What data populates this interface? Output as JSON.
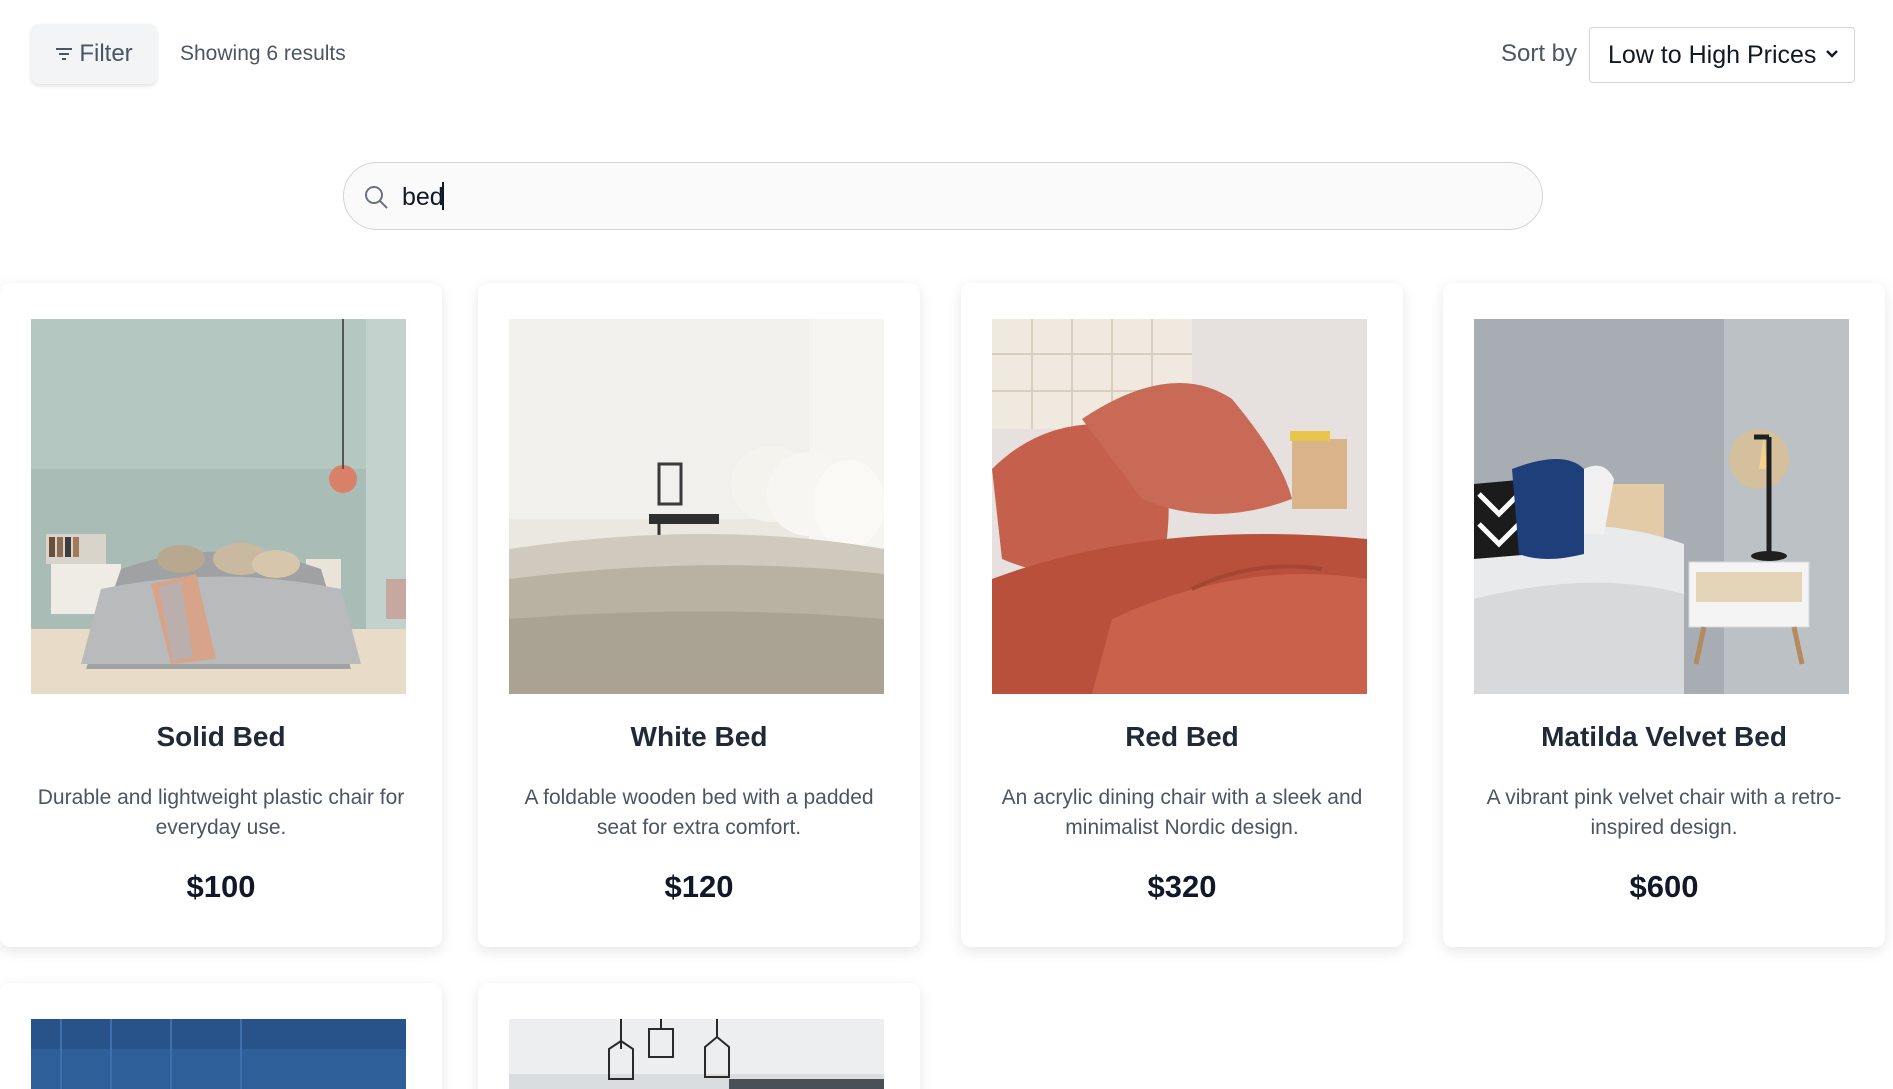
{
  "toolbar": {
    "filter_label": "Filter",
    "results_text": "Showing 6 results",
    "sort_label": "Sort by",
    "sort_value": "Low to High Prices"
  },
  "search": {
    "value": "bed"
  },
  "products": [
    {
      "title": "Solid Bed",
      "description": "Durable and lightweight plastic chair for everyday use.",
      "price": "$100"
    },
    {
      "title": "White Bed",
      "description": "A foldable wooden bed with a padded seat for extra comfort.",
      "price": "$120"
    },
    {
      "title": "Red Bed",
      "description": "An acrylic dining chair with a sleek and minimalist Nordic design.",
      "price": "$320"
    },
    {
      "title": "Matilda Velvet Bed",
      "description": "A vibrant pink velvet chair with a retro-inspired design.",
      "price": "$600"
    }
  ],
  "icons": {
    "filter": "filter-icon",
    "search": "search-icon",
    "sort": "chevron-down-icon"
  },
  "colors": {
    "text_primary": "#111827",
    "text_secondary": "#4b5563",
    "border": "#d1d5db",
    "filter_bg": "#f3f4f6"
  }
}
